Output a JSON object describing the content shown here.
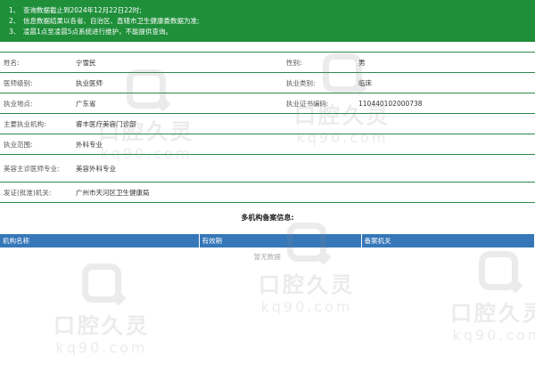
{
  "notice": {
    "items": [
      {
        "num": "1、",
        "text": "查询数据截止到2024年12月22日22时;"
      },
      {
        "num": "2、",
        "text": "信息数据结果以各省、自治区、直辖市卫生健康委数据为准;"
      },
      {
        "num": "3、",
        "text": "凌晨1点至凌晨5点系统进行维护，不能提供查询。"
      }
    ]
  },
  "profile": {
    "name_label": "姓名:",
    "name": "宁雪民",
    "gender_label": "性别:",
    "gender": "男",
    "level_label": "医师级别:",
    "level": "执业医师",
    "category_label": "执业类别:",
    "category": "临床",
    "location_label": "执业地点:",
    "location": "广东省",
    "cert_label": "执业证书编码:",
    "cert": "110440102000738",
    "institution_label": "主要执业机构:",
    "institution": "睿丰医疗美容门诊部",
    "scope_label": "执业范围:",
    "scope": "外科专业",
    "cosmetic_label": "美容主诊医师专业:",
    "cosmetic": "美容外科专业",
    "authority_label": "发证(批准)机关:",
    "authority": "广州市天河区卫生健康局"
  },
  "multi": {
    "title": "多机构备案信息:",
    "headers": [
      "机构名称",
      "有效期",
      "备案机关"
    ],
    "empty_text": "暂无数据"
  },
  "watermark": {
    "brand": "口腔久灵",
    "domain": "kq90.com"
  }
}
